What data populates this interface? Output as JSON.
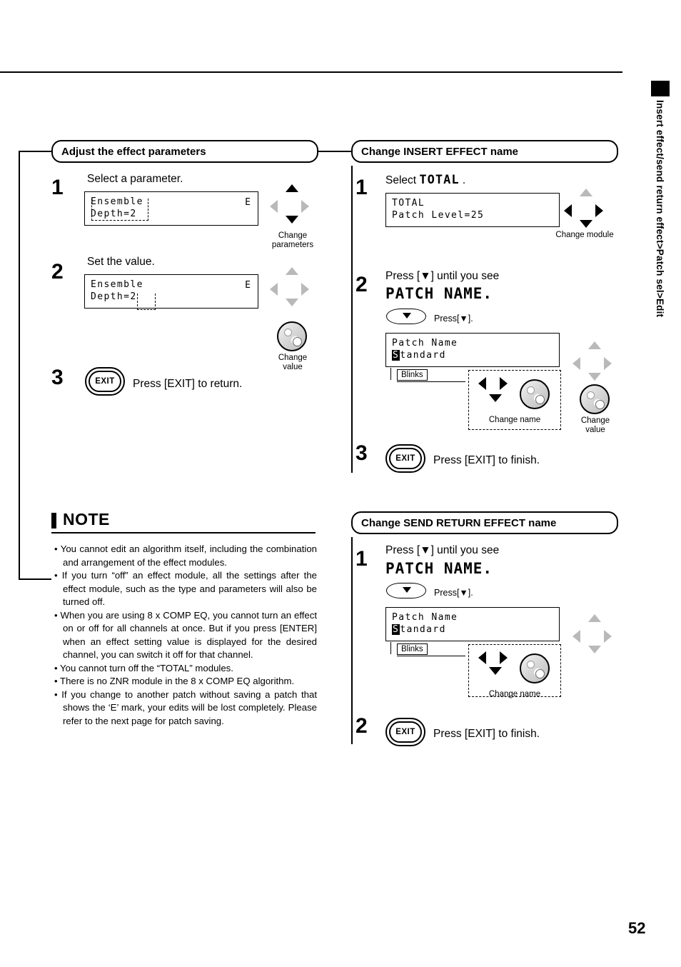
{
  "page": {
    "number": "52",
    "side_tab_text": "Insert effect/send return effect>Patch sel>Edit"
  },
  "sections": {
    "adjust": {
      "title": "Adjust the effect parameters",
      "steps": [
        {
          "num": "1",
          "text": "Select a parameter.",
          "lcd": {
            "line1": "Ensemble",
            "line2": "Depth=2",
            "right": "E"
          },
          "caption": "Change\nparameters"
        },
        {
          "num": "2",
          "text": "Set the value.",
          "lcd": {
            "line1": "Ensemble",
            "line2": "Depth=2",
            "right": "E"
          },
          "caption": "Change\nvalue"
        },
        {
          "num": "3",
          "button": "EXIT",
          "text": "Press [EXIT] to return."
        }
      ]
    },
    "note": {
      "title": "NOTE",
      "bullets": [
        "• You cannot edit an algorithm itself, including the combination and arrangement of the effect modules.",
        "• If you turn “off” an effect module, all the settings after the effect module, such as the type and parameters will also be turned off.",
        "• When you are using 8 x COMP EQ, you cannot turn an effect on or off for all channels at once. But if you press [ENTER] when an effect setting value is displayed for the desired channel, you can switch it off for that channel.",
        "• You cannot turn off the “TOTAL” modules.",
        "• There is no ZNR module in the 8 x COMP EQ algorithm.",
        "• If you change to another patch without saving a patch that shows the ‘E’ mark, your edits will be lost completely. Please refer to the next page for patch saving."
      ]
    },
    "insert_name": {
      "title": "Change INSERT EFFECT name",
      "steps": [
        {
          "num": "1",
          "text_prefix": "Select ",
          "text_mono": "TOTAL",
          "text_suffix": " .",
          "lcd": {
            "line1": "TOTAL",
            "line2": "Patch Level=25"
          },
          "caption": "Change module"
        },
        {
          "num": "2",
          "text": "Press [▼] until you see",
          "mono": "PATCH NAME.",
          "press_label": "Press[▼].",
          "lcd": {
            "line1": "Patch Name",
            "line2_inv": "S",
            "line2": "tandard"
          },
          "blinks": "Blinks",
          "caption_name": "Change name",
          "caption_value": "Change\nvalue"
        },
        {
          "num": "3",
          "button": "EXIT",
          "text": "Press [EXIT] to finish."
        }
      ]
    },
    "send_return_name": {
      "title": "Change SEND RETURN EFFECT name",
      "steps": [
        {
          "num": "1",
          "text": "Press [▼] until you see",
          "mono": "PATCH NAME.",
          "press_label": "Press[▼].",
          "lcd": {
            "line1": "Patch Name",
            "line2_inv": "S",
            "line2": "tandard"
          },
          "blinks": "Blinks",
          "caption_name": "Change name"
        },
        {
          "num": "2",
          "button": "EXIT",
          "text": "Press [EXIT] to finish."
        }
      ]
    }
  }
}
